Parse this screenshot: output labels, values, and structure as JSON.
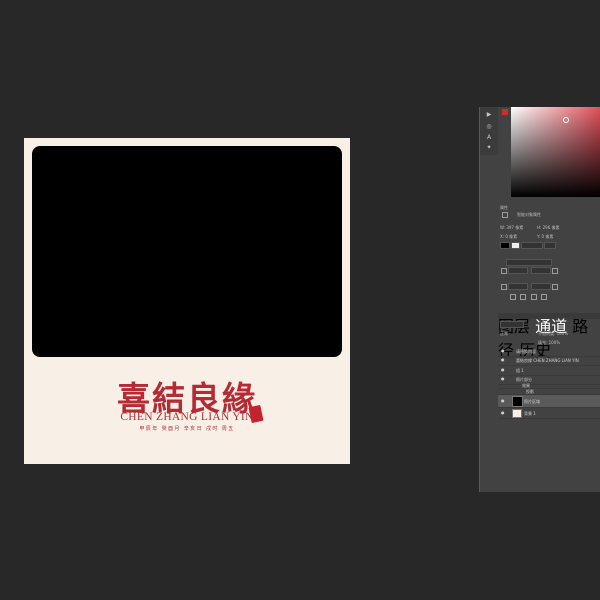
{
  "canvas": {
    "title_cn": "喜結良緣",
    "title_en": "CHEN ZHANG LIAN YIN",
    "date_line": "甲辰年 癸酉月 辛亥日 戌时 周五"
  },
  "tools": [
    "move-icon",
    "lasso-icon",
    "brush-icon",
    "hand-icon"
  ],
  "colors": {
    "foreground": "#d42a2a",
    "canvas_bg": "#f8efe6",
    "accent": "#b42a35"
  },
  "properties": {
    "header": "属性",
    "kind": "智能对象属性",
    "w_label": "W: 397 像素",
    "h_label": "H: 296 像素",
    "x_label": "X: 0 像素",
    "y_label": "Y: 0 像素"
  },
  "layers": {
    "tabs": [
      "图层",
      "通道",
      "路径",
      "历史"
    ],
    "blend_mode": "正常",
    "opacity": "不透明度: 100%",
    "fill": "填充: 100%",
    "rows": [
      {
        "name": "请替换内容",
        "type": "group"
      },
      {
        "name": "喜結良緣 CHEN ZHANG LIAN YIN",
        "type": "text"
      },
      {
        "name": "组 1",
        "type": "group"
      },
      {
        "name": "照片部分",
        "type": "group"
      },
      {
        "name": "效果",
        "type": "effect"
      },
      {
        "name": "投影",
        "type": "effect"
      },
      {
        "name": "照片区域",
        "type": "smart",
        "selected": true
      },
      {
        "name": "背景 1",
        "type": "layer"
      }
    ]
  }
}
